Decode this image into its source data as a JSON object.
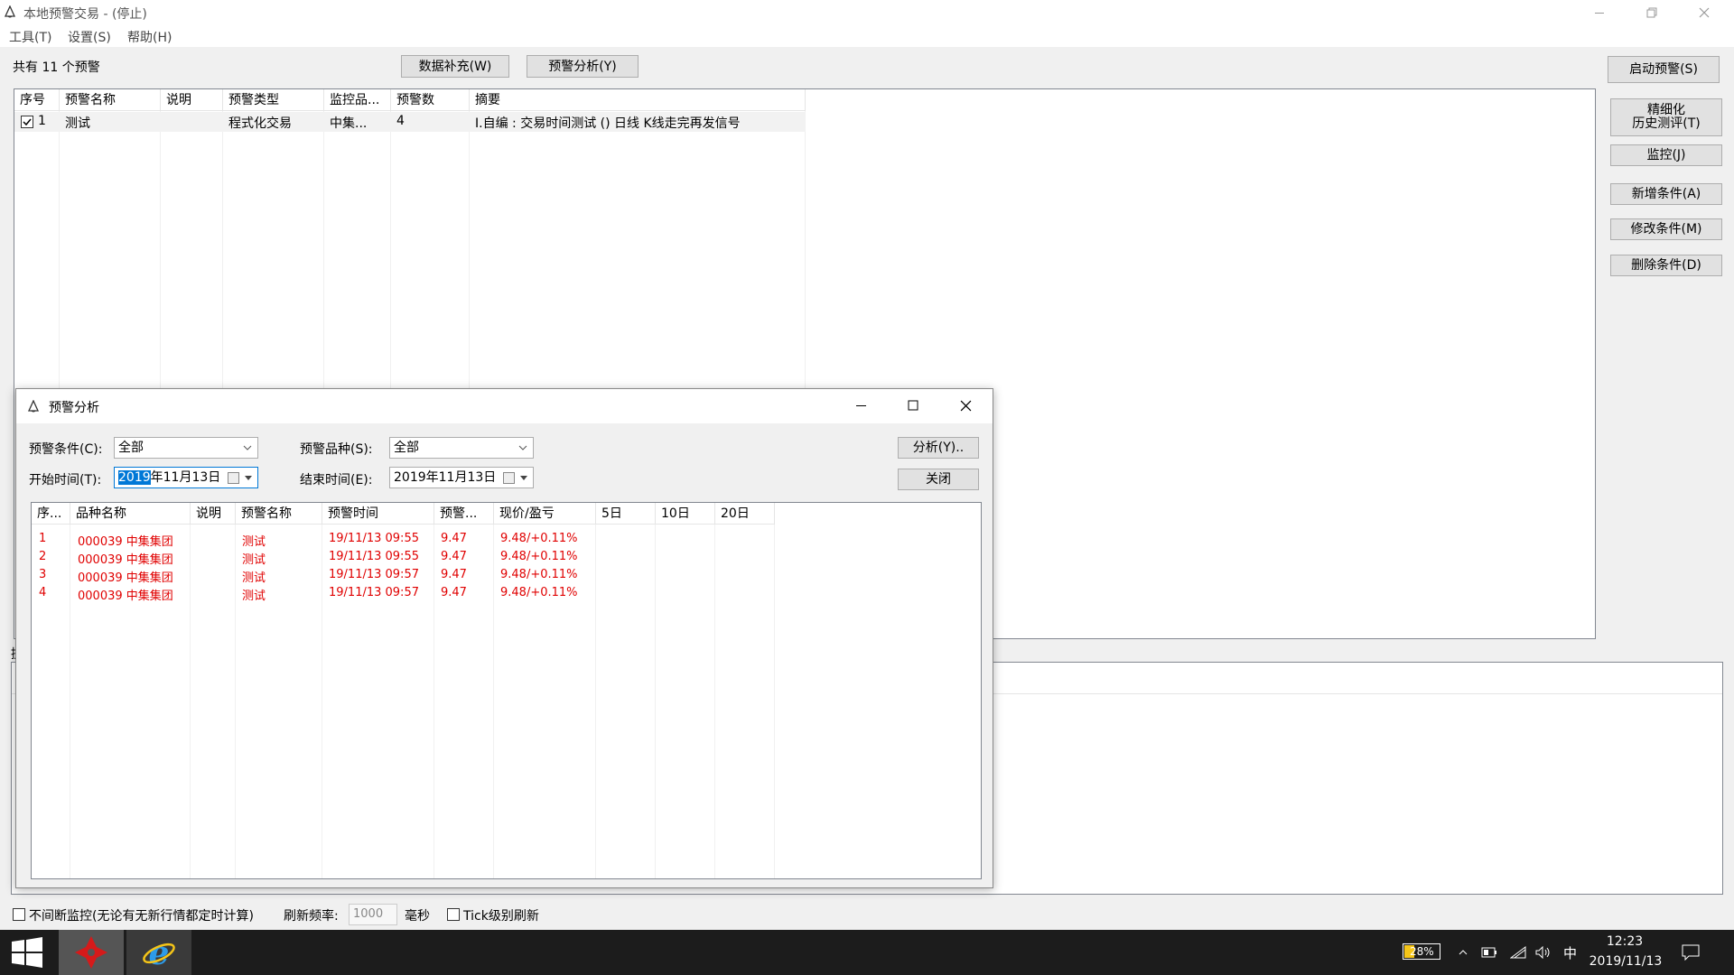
{
  "window": {
    "title": "本地预警交易 - (停止)"
  },
  "menu": [
    "工具(T)",
    "设置(S)",
    "帮助(H)"
  ],
  "toolbar": {
    "count_label": "共有 11 个预警",
    "data_fill": "数据补充(W)",
    "alert_analysis": "预警分析(Y)"
  },
  "side_buttons": [
    "启动预警(S)",
    "精细化\n历史测评(T)",
    "监控(J)",
    "新增条件(A)",
    "修改条件(M)",
    "删除条件(D)"
  ],
  "main_table": {
    "headers": [
      "序号",
      "预警名称",
      "说明",
      "预警类型",
      "监控品...",
      "预警数",
      "摘要"
    ],
    "rows": [
      {
        "checked": true,
        "cells": [
          "1",
          "测试",
          "",
          "程式化交易",
          "中集...",
          "4",
          "I.自编 : 交易时间测试 () 日线 K线走完再发信号"
        ]
      }
    ]
  },
  "dialog": {
    "title": "预警分析",
    "cond_label": "预警条件(C):",
    "cond_value": "全部",
    "variety_label": "预警品种(S):",
    "variety_value": "全部",
    "start_label": "开始时间(T):",
    "start_year": "2019",
    "start_rest": "年11月13日",
    "end_label": "结束时间(E):",
    "end_value": "2019年11月13日",
    "analyze_btn": "分析(Y)..",
    "close_btn": "关闭",
    "headers": [
      "序...",
      "品种名称",
      "说明",
      "预警名称",
      "预警时间",
      "预警...",
      "现价/盈亏",
      "5日",
      "10日",
      "20日"
    ],
    "rows": [
      [
        "1",
        "000039 中集集团",
        "",
        "测试",
        "19/11/13 09:55",
        "9.47",
        "9.48/+0.11%",
        "",
        "",
        ""
      ],
      [
        "2",
        "000039 中集集团",
        "",
        "测试",
        "19/11/13 09:55",
        "9.47",
        "9.48/+0.11%",
        "",
        "",
        ""
      ],
      [
        "3",
        "000039 中集集团",
        "",
        "测试",
        "19/11/13 09:57",
        "9.47",
        "9.48/+0.11%",
        "",
        "",
        ""
      ],
      [
        "4",
        "000039 中集集团",
        "",
        "测试",
        "19/11/13 09:57",
        "9.47",
        "9.48/+0.11%",
        "",
        "",
        ""
      ]
    ]
  },
  "bottom": {
    "continuous_label": "不间断监控(无论有无新行情都定时计算)",
    "refresh_label": "刷新频率:",
    "refresh_value": "1000",
    "ms_label": "毫秒",
    "tick_label": "Tick级别刷新"
  },
  "taskbar": {
    "battery": "28%",
    "ime": "中",
    "time": "12:23",
    "date": "2019/11/13"
  },
  "colors": {
    "alert_red": "#e00000",
    "taskbar": "#1c1c1c",
    "selection": "#0078d7"
  }
}
